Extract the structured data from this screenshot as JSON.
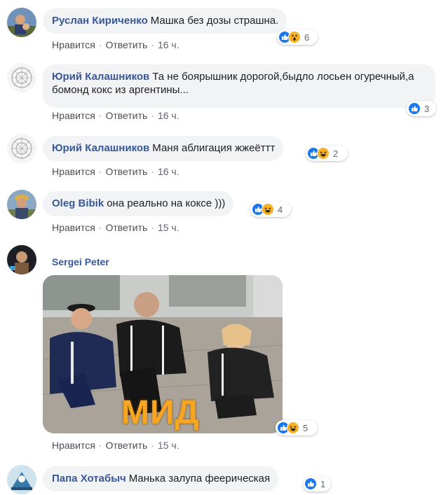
{
  "actions": {
    "like": "Нравится",
    "reply": "Ответить"
  },
  "comments": [
    {
      "author": "Руслан Кириченко",
      "text": "Машка без дозы страшна.",
      "time": "16 ч.",
      "reaction_count": "6",
      "reaction_icons": [
        "like-icon",
        "wow-icon"
      ]
    },
    {
      "author": "Юрий Калашников",
      "text": "Та не боярышник дорогой,быдло лосьен огуречный,а бомонд кокс из аргентины...",
      "time": "16 ч.",
      "reaction_count": "3",
      "reaction_icons": [
        "like-icon"
      ]
    },
    {
      "author": "Юрий Калашников",
      "text": "Маня аблигация жжеёттт",
      "time": "16 ч.",
      "reaction_count": "2",
      "reaction_icons": [
        "like-icon",
        "haha-icon"
      ]
    },
    {
      "author": "Oleg Bibik",
      "text": "она реально на коксе )))",
      "time": "15 ч.",
      "reaction_count": "4",
      "reaction_icons": [
        "like-icon",
        "haha-icon"
      ]
    },
    {
      "author": "Sergei Peter",
      "image_caption": "МИД",
      "time": "15 ч.",
      "reaction_count": "5",
      "reaction_icons": [
        "like-icon",
        "haha-icon"
      ]
    },
    {
      "author": "Папа Хотабыч",
      "text": "Манька залупа феерическая",
      "reaction_count": "1",
      "reaction_icons": [
        "like-icon"
      ]
    }
  ],
  "colors": {
    "author": "#385898",
    "bubble": "#f2f3f5",
    "like": "#1877f2",
    "emoji": "#f7b125",
    "caption": "#f6a623"
  }
}
